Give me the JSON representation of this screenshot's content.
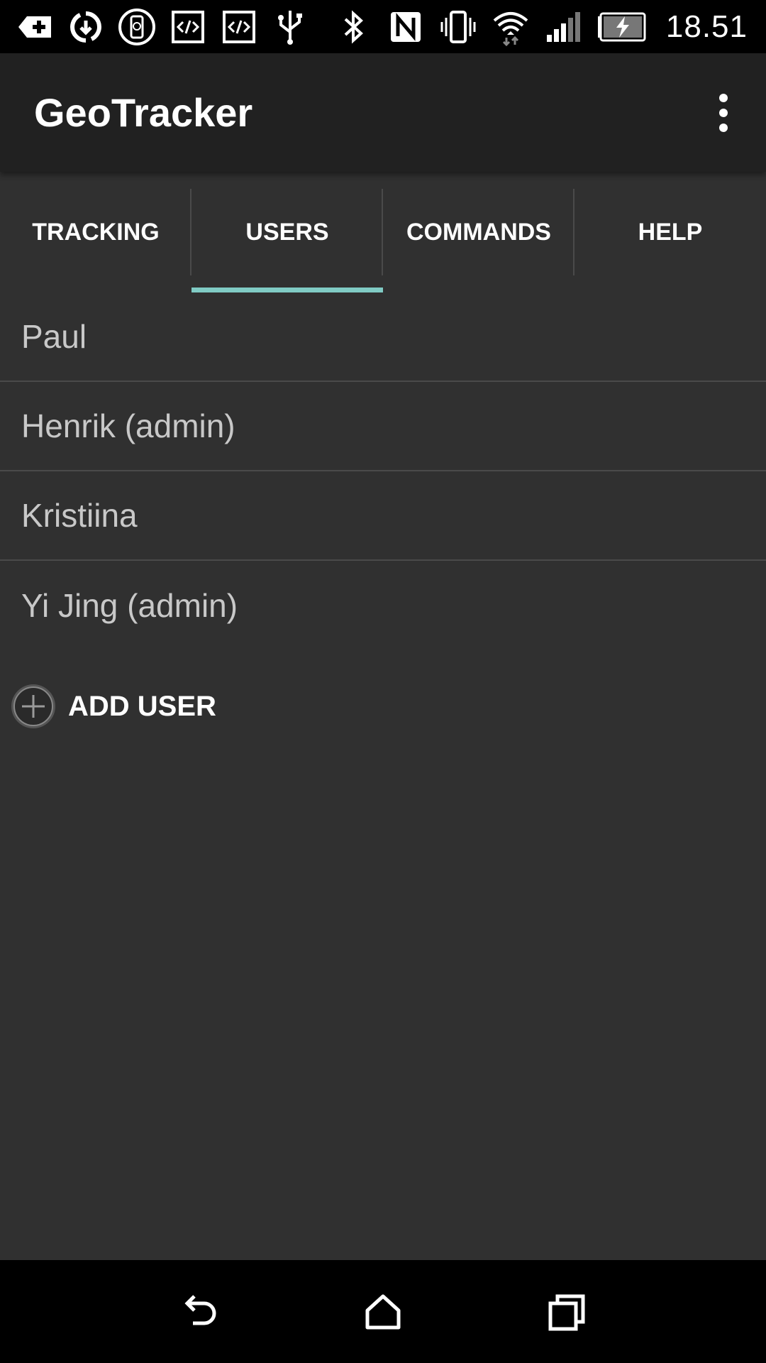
{
  "status_bar": {
    "time": "18.51",
    "icons": [
      "add-notification-icon",
      "sync-icon",
      "device-icon",
      "code-icon",
      "code-icon",
      "usb-icon",
      "bluetooth-icon",
      "nfc-icon",
      "vibrate-icon",
      "wifi-icon",
      "signal-icon",
      "battery-charging-icon"
    ]
  },
  "app_bar": {
    "title": "GeoTracker",
    "menu_icon": "overflow-menu-icon"
  },
  "tabs": [
    {
      "label": "TRACKING",
      "selected": false
    },
    {
      "label": "USERS",
      "selected": true
    },
    {
      "label": "COMMANDS",
      "selected": false
    },
    {
      "label": "HELP",
      "selected": false
    }
  ],
  "users": [
    {
      "name": "Paul"
    },
    {
      "name": "Henrik (admin)"
    },
    {
      "name": "Kristiina"
    },
    {
      "name": "Yi Jing (admin)"
    }
  ],
  "add_user": {
    "label": "ADD USER",
    "icon": "add-circle-icon"
  },
  "colors": {
    "background": "#303030",
    "app_bar": "#212121",
    "tab_indicator": "#80cbc4",
    "list_text": "#c8c8c8",
    "divider": "#4a4a4a"
  },
  "nav_bar": {
    "icons": [
      "back-icon",
      "home-icon",
      "recents-icon"
    ]
  }
}
